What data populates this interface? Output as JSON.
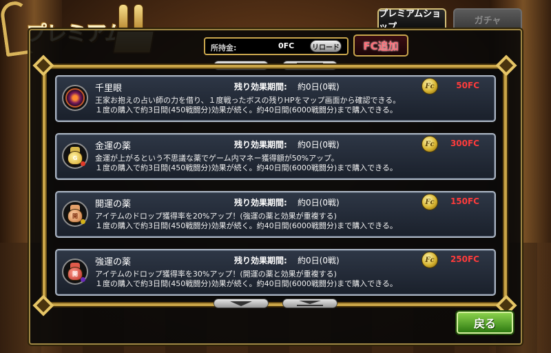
{
  "title": "プレミアム",
  "tabs": [
    {
      "label": "プレミアムショップ",
      "active": true
    },
    {
      "label": "ガチャ",
      "active": false
    }
  ],
  "money": {
    "label": "所持金:",
    "value": "0FC",
    "reload_label": "リロード",
    "fc_add_label": "FC追加"
  },
  "items": [
    {
      "name": "千里眼",
      "icon": "eye-icon",
      "period_label": "残り効果期間:",
      "period_value": "約0日(0戦)",
      "coin_symbol": "Fc",
      "price": "50FC",
      "desc1": "王家お抱えの占い師の力を借り、１度戦ったボスの残りHPをマップ画面から確認できる。",
      "desc2": "１度の購入で約3日間(450戦闘分)効果が続く。約40日間(6000戦闘分)まで購入できる。"
    },
    {
      "name": "金運の薬",
      "icon": "gold-bag-icon",
      "period_label": "残り効果期間:",
      "period_value": "約0日(0戦)",
      "coin_symbol": "Fc",
      "price": "300FC",
      "desc1": "金運が上がるという不思議な薬でゲーム内マネー獲得額が50%アップ。",
      "desc2": "１度の購入で約3日間(450戦闘分)効果が続く。約40日間(6000戦闘分)まで購入できる。"
    },
    {
      "name": "開運の薬",
      "icon": "luck-bag-icon",
      "period_label": "残り効果期間:",
      "period_value": "約0日(0戦)",
      "coin_symbol": "Fc",
      "price": "150FC",
      "desc1": "アイテムのドロップ獲得率を20%アップ！(強運の薬と効果が重複する)",
      "desc2": "１度の購入で約3日間(450戦闘分)効果が続く。約40日間(6000戦闘分)まで購入できる。"
    },
    {
      "name": "強運の薬",
      "icon": "strong-luck-bag-icon",
      "period_label": "残り効果期間:",
      "period_value": "約0日(0戦)",
      "coin_symbol": "Fc",
      "price": "250FC",
      "desc1": "アイテムのドロップ獲得率を30%アップ！(開運の薬と効果が重複する)",
      "desc2": "１度の購入で約3日間(450戦闘分)効果が続く。約40日間(6000戦闘分)まで購入できる。"
    }
  ],
  "bag_labels": {
    "gold": "G",
    "luck": "開",
    "strong": "開"
  },
  "back_label": "戻る",
  "colors": {
    "price": "#ff3b3b",
    "frame_gold": "#caa548",
    "back_green": "#4aa822"
  }
}
